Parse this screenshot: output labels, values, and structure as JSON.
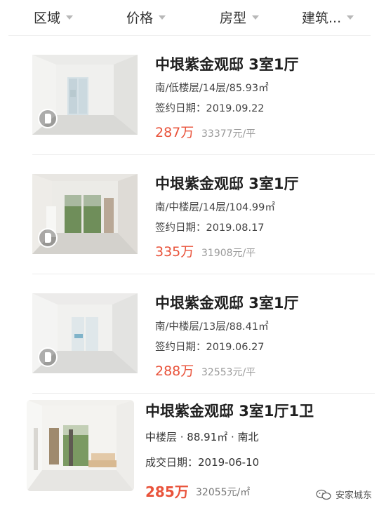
{
  "filters": [
    {
      "label": "区域"
    },
    {
      "label": "价格"
    },
    {
      "label": "房型"
    },
    {
      "label": "建筑..."
    }
  ],
  "listings": [
    {
      "title": "中垠紫金观邸 3室1厅",
      "info": "南/低楼层/14层/85.93㎡",
      "date": "签约日期：2019.09.22",
      "price": "287万",
      "unit_price": "33377元/平"
    },
    {
      "title": "中垠紫金观邸 3室1厅",
      "info": "南/中楼层/14层/104.99㎡",
      "date": "签约日期：2019.08.17",
      "price": "335万",
      "unit_price": "31908元/平"
    },
    {
      "title": "中垠紫金观邸 3室1厅",
      "info": "南/中楼层/13层/88.41㎡",
      "date": "签约日期：2019.06.27",
      "price": "288万",
      "unit_price": "32553元/平"
    }
  ],
  "listing4": {
    "title": "中垠紫金观邸 3室1厅1卫",
    "info": "中楼层 · 88.91㎡ · 南北",
    "date": "成交日期：2019-06-10",
    "price": "285万",
    "unit_price": "32055元/㎡"
  },
  "watermark": {
    "text": "安家城东"
  },
  "colors": {
    "price": "#e9533b",
    "caret": "#b8b8b8",
    "divider": "#ececec"
  }
}
